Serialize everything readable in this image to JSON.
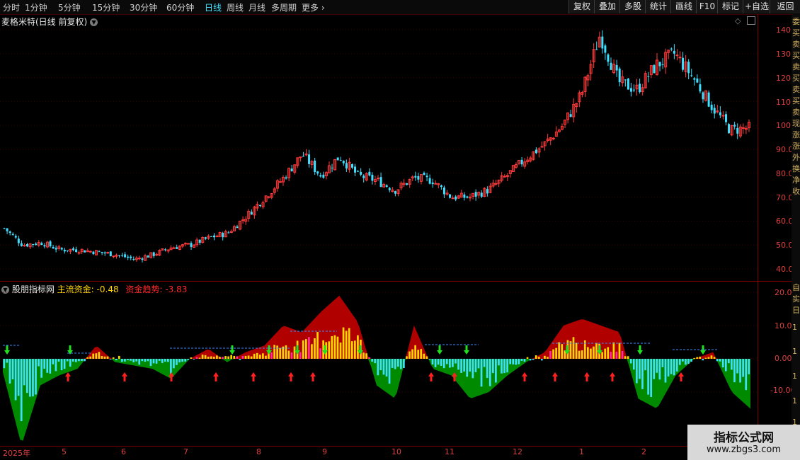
{
  "toolbar": {
    "periods": [
      "分时",
      "1分钟",
      "5分钟",
      "15分钟",
      "30分钟",
      "60分钟",
      "日线",
      "周线",
      "月线",
      "多周期",
      "更多"
    ],
    "active_period": "日线",
    "buttons": [
      "复权",
      "叠加",
      "多股",
      "统计",
      "画线",
      "F10",
      "标记",
      "+自选",
      "返回"
    ]
  },
  "chart_title": "麦格米特(日线 前复权)",
  "indicator": {
    "name": "股朋指标网",
    "main_flow_label": "主流资金:",
    "main_flow_value": "-0.48",
    "trend_label": "资金趋势:",
    "trend_value": "-3.83"
  },
  "price_axis": [
    "140.0",
    "130.0",
    "120.0",
    "110.0",
    "100.0",
    "90.00",
    "80.00",
    "70.00",
    "60.00",
    "50.00",
    "40.00"
  ],
  "ind_axis": [
    "20.00",
    "10.00",
    "0.00",
    "-10.00"
  ],
  "x_axis": [
    "2025年",
    "5",
    "6",
    "7",
    "8",
    "9",
    "10",
    "11",
    "12",
    "1",
    "2"
  ],
  "right_col_chars": [
    "委",
    "买",
    "卖",
    "买",
    "卖",
    "买",
    "卖",
    "买",
    "卖",
    "现",
    "涨",
    "涨",
    "外",
    "换",
    "净",
    "收",
    "自",
    "实",
    "日",
    "1",
    "1",
    "1",
    "1",
    "1"
  ],
  "watermark": {
    "line1": "指标公式网",
    "line2": "www.zbgs3.com"
  },
  "colors": {
    "up": "#ff3b3b",
    "down": "#3fe0ff",
    "accent": "#3fe0ff",
    "main_flow": "#ffd700",
    "trend": "#ff2a2a",
    "inflow_area": "#b00000",
    "outflow_area": "#008a00"
  },
  "chart_data": [
    {
      "type": "candlestick",
      "title": "麦格米特(日线 前复权)",
      "ylim": [
        37,
        142
      ],
      "x_ticks": [
        "2025年",
        "5",
        "6",
        "7",
        "8",
        "9",
        "10",
        "11",
        "12",
        "1",
        "2"
      ],
      "close_trend": [
        [
          0,
          57
        ],
        [
          1,
          50
        ],
        [
          2,
          51
        ],
        [
          3,
          48
        ],
        [
          4,
          48
        ],
        [
          5,
          47
        ],
        [
          6,
          46
        ],
        [
          7,
          44
        ],
        [
          8,
          46
        ],
        [
          9,
          49
        ],
        [
          10,
          50
        ],
        [
          11,
          53
        ],
        [
          12,
          55
        ],
        [
          13,
          62
        ],
        [
          14,
          70
        ],
        [
          15,
          78
        ],
        [
          16,
          88
        ],
        [
          17,
          79
        ],
        [
          18,
          87
        ],
        [
          19,
          79
        ],
        [
          20,
          77
        ],
        [
          21,
          73
        ],
        [
          22,
          78
        ],
        [
          23,
          77
        ],
        [
          24,
          70
        ],
        [
          25,
          70
        ],
        [
          26,
          73
        ],
        [
          27,
          79
        ],
        [
          28,
          86
        ],
        [
          29,
          92
        ],
        [
          30,
          100
        ],
        [
          31,
          113
        ],
        [
          32,
          138
        ],
        [
          33,
          118
        ],
        [
          34,
          115
        ],
        [
          35,
          125
        ],
        [
          36,
          130
        ],
        [
          37,
          120
        ],
        [
          38,
          108
        ],
        [
          39,
          98
        ],
        [
          40,
          99
        ]
      ]
    },
    {
      "type": "bar",
      "title": "股朋指标网",
      "series": [
        {
          "name": "主流资金",
          "last": -0.48
        },
        {
          "name": "资金趋势",
          "last": -3.83
        }
      ],
      "ylim": [
        -26,
        22
      ],
      "trend_shape": [
        [
          0,
          -4
        ],
        [
          1,
          -26
        ],
        [
          2,
          -8
        ],
        [
          3,
          -5
        ],
        [
          4,
          -3
        ],
        [
          5,
          4
        ],
        [
          6,
          -1
        ],
        [
          7,
          -2
        ],
        [
          8,
          -3
        ],
        [
          9,
          -6
        ],
        [
          10,
          0
        ],
        [
          11,
          3
        ],
        [
          12,
          -1
        ],
        [
          13,
          2
        ],
        [
          14,
          4
        ],
        [
          15,
          10
        ],
        [
          16,
          8
        ],
        [
          17,
          14
        ],
        [
          18,
          19
        ],
        [
          19,
          11
        ],
        [
          20,
          -8
        ],
        [
          21,
          -12
        ],
        [
          22,
          10
        ],
        [
          23,
          -3
        ],
        [
          24,
          -5
        ],
        [
          25,
          -12
        ],
        [
          26,
          -10
        ],
        [
          27,
          -5
        ],
        [
          28,
          -1
        ],
        [
          29,
          2
        ],
        [
          30,
          10
        ],
        [
          31,
          12
        ],
        [
          32,
          10
        ],
        [
          33,
          8
        ],
        [
          34,
          -12
        ],
        [
          35,
          -15
        ],
        [
          36,
          -5
        ],
        [
          37,
          0
        ],
        [
          38,
          2
        ],
        [
          39,
          -10
        ],
        [
          40,
          -15
        ]
      ]
    }
  ]
}
